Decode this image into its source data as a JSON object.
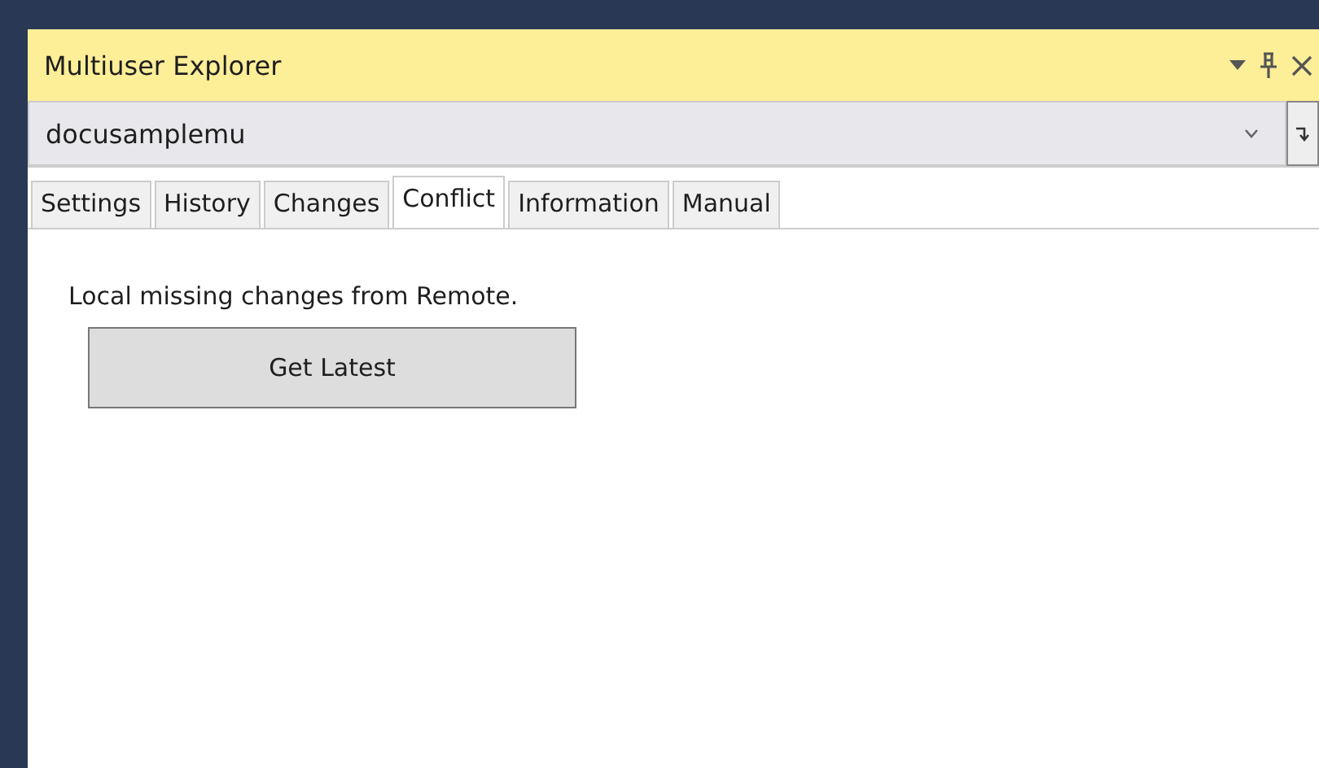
{
  "window": {
    "title": "Multiuser Explorer"
  },
  "combo": {
    "value": "docusamplemu"
  },
  "tabs": [
    {
      "label": "Settings",
      "selected": false
    },
    {
      "label": "History",
      "selected": false
    },
    {
      "label": "Changes",
      "selected": false
    },
    {
      "label": "Conflict",
      "selected": true
    },
    {
      "label": "Information",
      "selected": false
    },
    {
      "label": "Manual",
      "selected": false
    }
  ],
  "content": {
    "message": "Local missing changes from Remote.",
    "button": "Get Latest"
  }
}
